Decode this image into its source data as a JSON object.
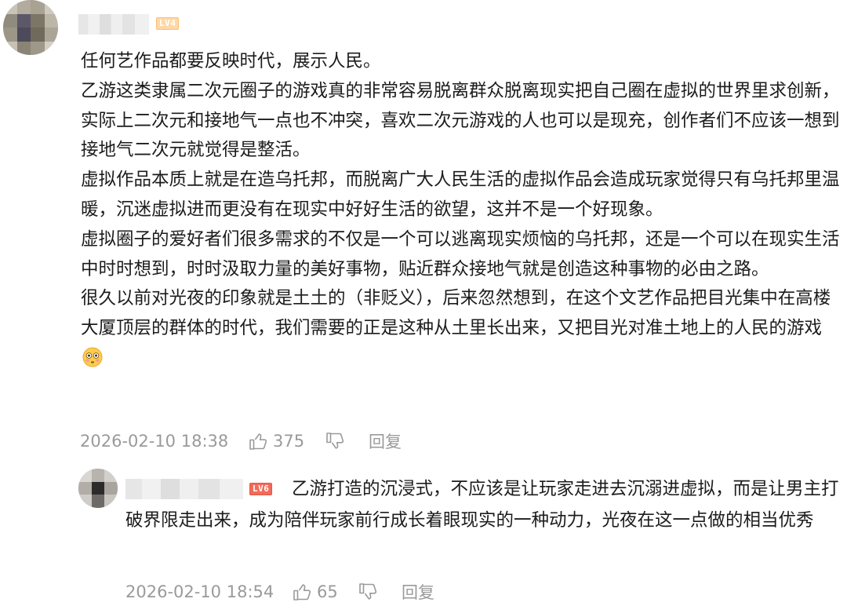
{
  "comment": {
    "level_badge": "LV4",
    "paragraphs": [
      "任何艺作品都要反映时代，展示人民。",
      "乙游这类隶属二次元圈子的游戏真的非常容易脱离群众脱离现实把自己圈在虚拟的世界里求创新，实际上二次元和接地气一点也不冲突，喜欢二次元游戏的人也可以是现充，创作者们不应该一想到接地气二次元就觉得是整活。",
      "虚拟作品本质上就是在造乌托邦，而脱离广大人民生活的虚拟作品会造成玩家觉得只有乌托邦里温暖，沉迷虚拟进而更没有在现实中好好生活的欲望，这并不是一个好现象。",
      "虚拟圈子的爱好者们很多需求的不仅是一个可以逃离现实烦恼的乌托邦，还是一个可以在现实生活中时时想到，时时汲取力量的美好事物，贴近群众接地气就是创造这种事物的必由之路。",
      "很久以前对光夜的印象就是土土的（非贬义），后来忽然想到，在这个文艺作品把目光集中在高楼大厦顶层的群体的时代，我们需要的正是这种从土里长出来，又把目光对准土地上的人民的游戏"
    ],
    "emoji": "flushed-face-emoji",
    "timestamp": "2026-02-10 18:38",
    "likes": "375",
    "reply_label": "回复"
  },
  "reply": {
    "level_badge": "LV6",
    "text": "乙游打造的沉浸式，不应该是让玩家走进去沉溺进虚拟，而是让男主打破界限走出来，成为陪伴玩家前行成长着眼现实的一种动力，光夜在这一点做的相当优秀",
    "timestamp": "2026-02-10 18:54",
    "likes": "65",
    "reply_label": "回复"
  },
  "colors": {
    "text": "#1c1c1c",
    "meta": "#9a9a9a",
    "lv4_badge": "#ffd8a6",
    "lv6_badge": "#f36a5a"
  }
}
